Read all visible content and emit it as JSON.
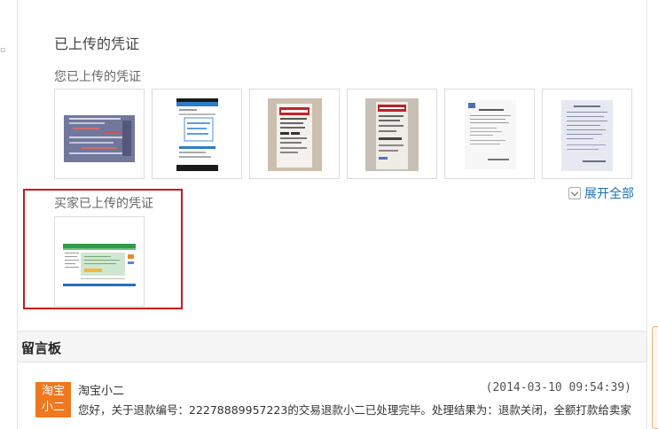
{
  "evidence": {
    "section_title": "已上传的凭证",
    "mine_label": "您已上传的凭证",
    "buyer_label": "买家已上传的凭证",
    "expand_label": "展开全部"
  },
  "message_board": {
    "title": "留言板",
    "messages": [
      {
        "avatar_line1": "淘宝",
        "avatar_line2": "小二",
        "author": "淘宝小二",
        "time": "(2014-03-10 09:54:39)",
        "text": "您好，关于退款编号：22278889957223的交易退款小二已处理完毕。处理结果为：退款关闭，全额打款给卖家"
      }
    ]
  },
  "colors": {
    "link": "#1f6fb5",
    "highlight_border": "#d0161b",
    "avatar_bg": "#f0781e"
  }
}
